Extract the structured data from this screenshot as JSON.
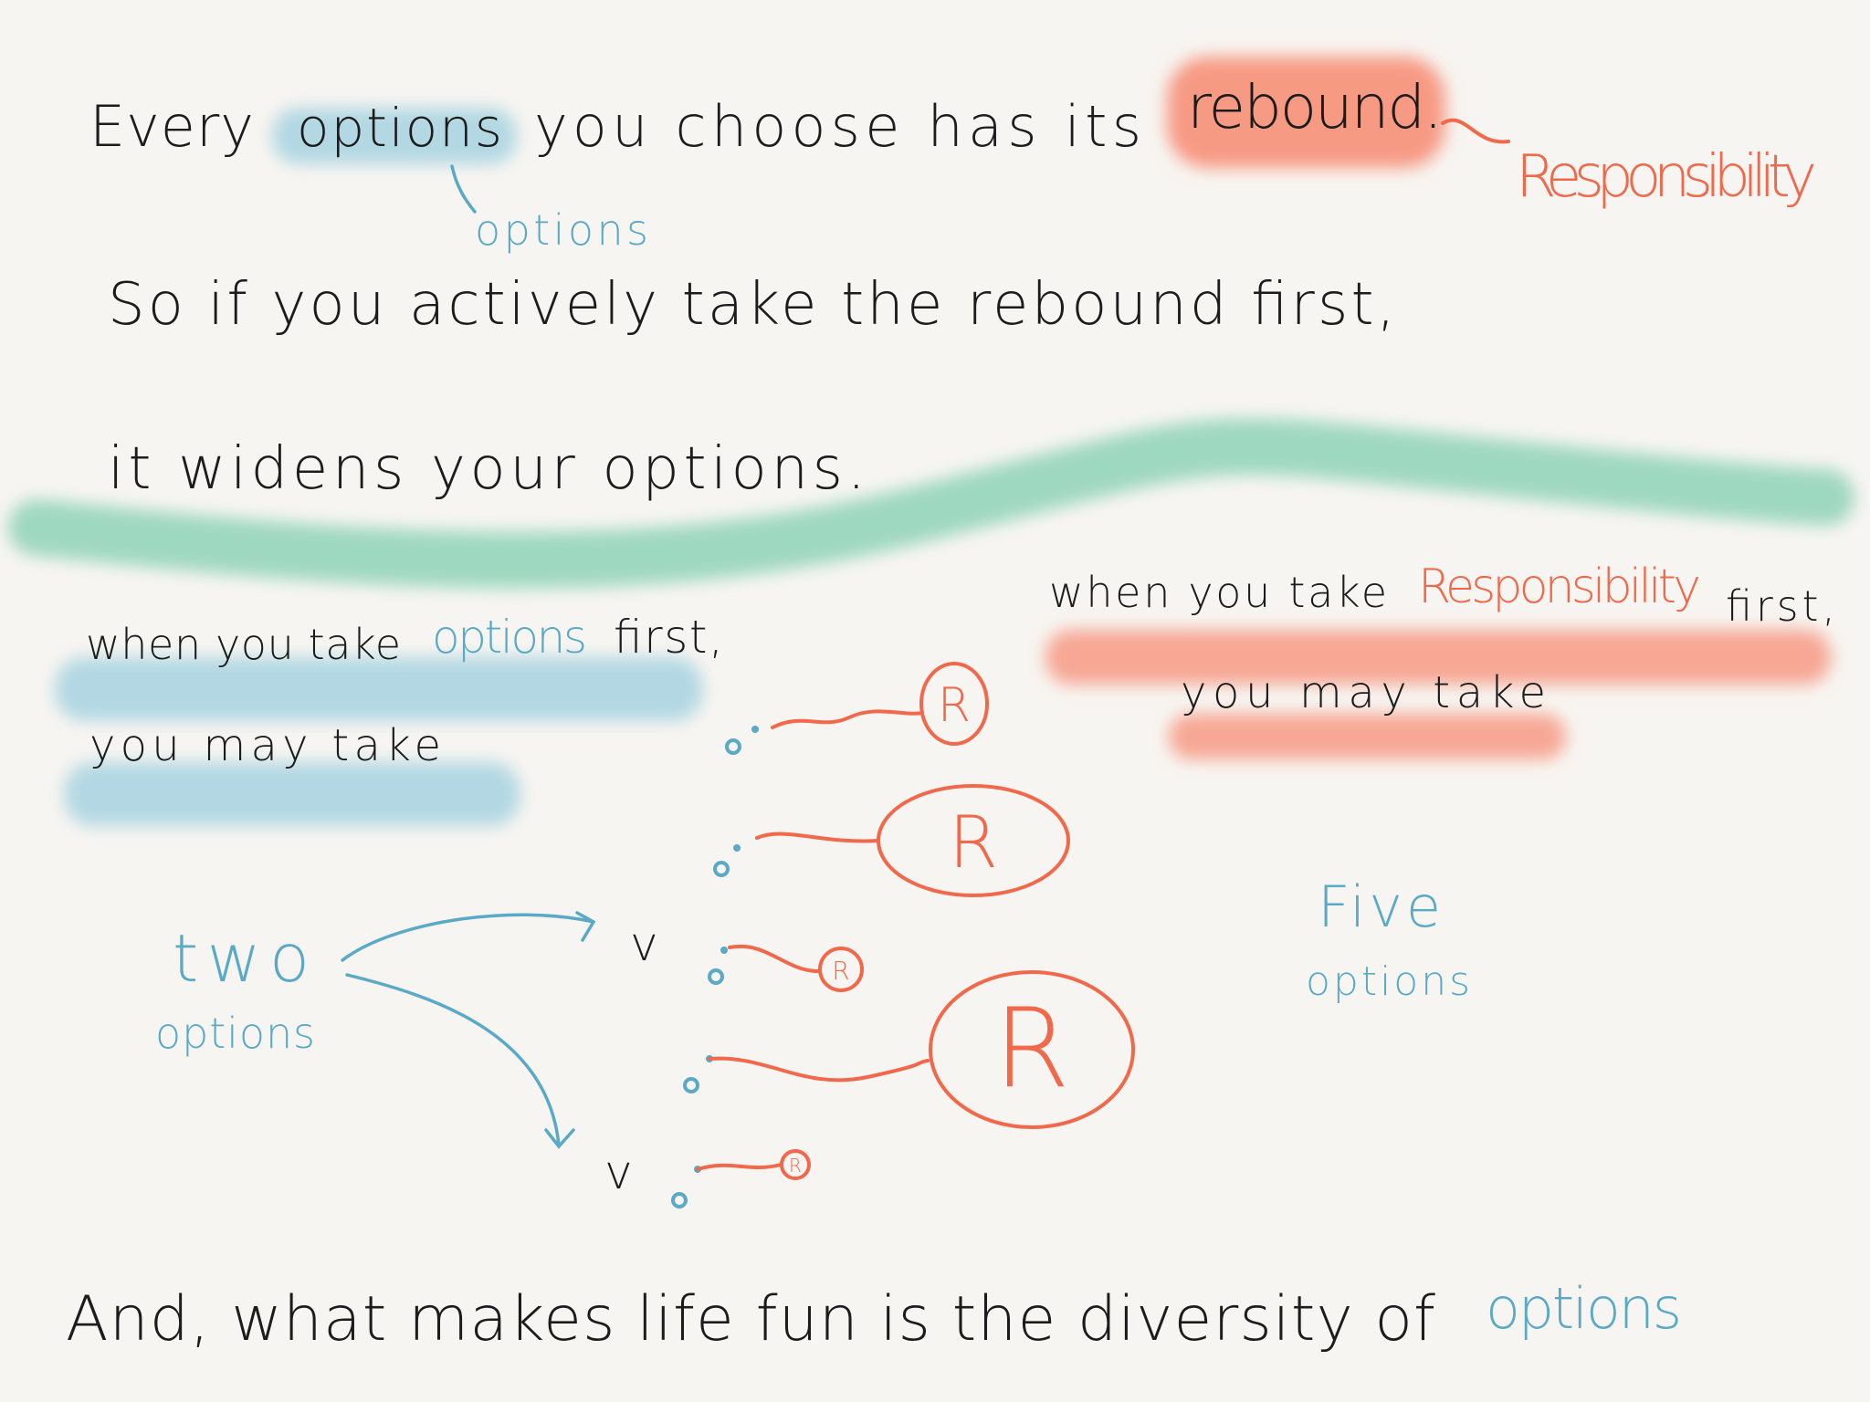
{
  "colors": {
    "background": "#f7f5f1",
    "ink": "#1c1c1c",
    "blue": "#5aa9c6",
    "red": "#f2684b",
    "green_highlight": "#9fd8c0",
    "blue_highlight": "#b3d8e3",
    "red_highlight": "#f79a84"
  },
  "line1": {
    "before": "Every",
    "highlight_blue": "options",
    "middle": "you choose has its",
    "highlight_red": "rebound."
  },
  "annotation_options": "options",
  "annotation_responsibility": "Responsibility",
  "line2": "So if you actively take the rebound first,",
  "line3": "it widens your options.",
  "left": {
    "line1_a": "when you take",
    "line1_b": "options",
    "line1_c": "first,",
    "line2": "you may take",
    "count_word": "two",
    "count_label": "options",
    "choice_mark": "v"
  },
  "right": {
    "line1_a": "when you take",
    "line1_b": "Responsibility",
    "line1_c": "first,",
    "line2": "you may take",
    "count_word": "Five",
    "count_label": "options",
    "circle_letter": "R"
  },
  "footer": {
    "text": "And, what makes life fun is the diversity of",
    "highlight": "options"
  }
}
